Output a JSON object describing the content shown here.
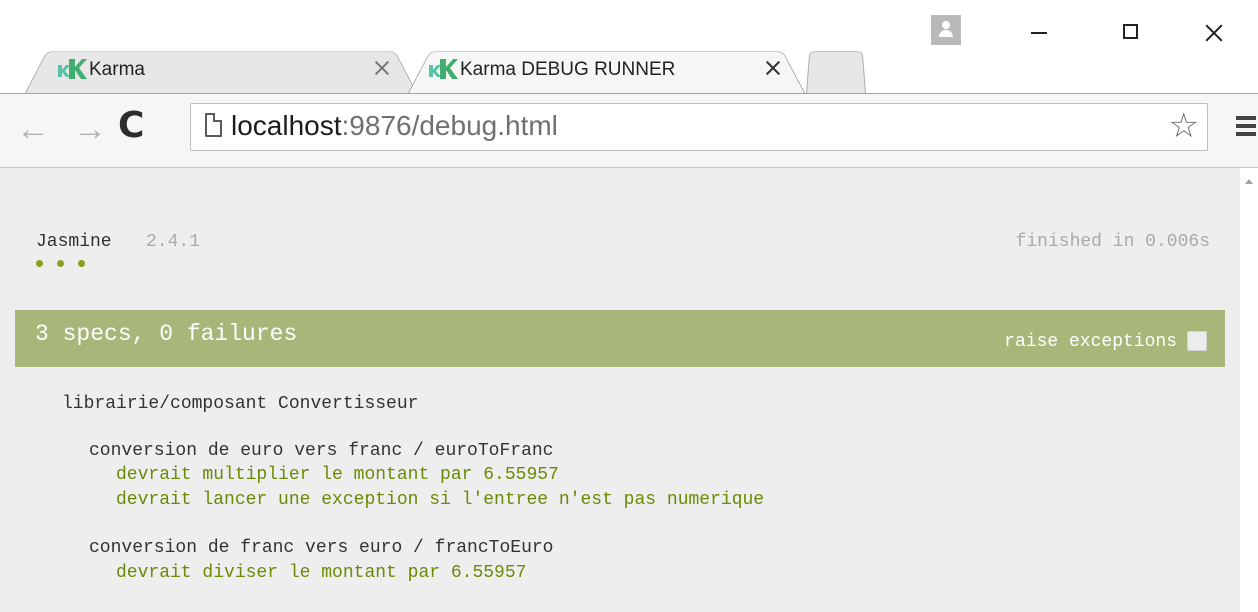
{
  "window": {
    "controls": [
      "minimize",
      "maximize",
      "close"
    ]
  },
  "tabs": [
    {
      "label": "Karma",
      "active": false,
      "icon": "karma-logo-icon"
    },
    {
      "label": "Karma DEBUG RUNNER",
      "active": true,
      "icon": "karma-logo-icon"
    }
  ],
  "toolbar": {
    "url_host": "localhost",
    "url_rest": ":9876/debug.html"
  },
  "jasmine": {
    "name": "Jasmine",
    "version": "2.4.1",
    "duration": "finished in 0.006s",
    "dots": 3,
    "dot_color": "#8a9f1f",
    "summary": "3 specs, 0 failures",
    "summary_color": "#a6b779",
    "raise_exceptions_label": "raise exceptions",
    "raise_exceptions_checked": false
  },
  "results": {
    "suite": "librairie/composant Convertisseur",
    "groups": [
      {
        "title": "conversion de euro vers franc / euroToFranc",
        "specs": [
          "devrait multiplier le montant par 6.55957",
          "devrait lancer une exception si l'entree n'est pas numerique"
        ]
      },
      {
        "title": "conversion de franc vers euro / francToEuro",
        "specs": [
          "devrait diviser le montant par 6.55957"
        ]
      }
    ]
  }
}
